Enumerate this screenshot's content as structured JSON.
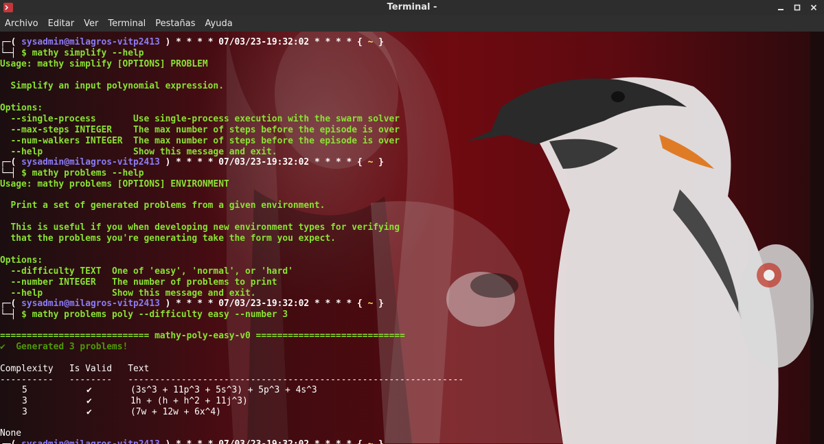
{
  "window": {
    "title": "Terminal -",
    "buttons": [
      "_",
      "□",
      "✕"
    ]
  },
  "menu": [
    "Archivo",
    "Editar",
    "Ver",
    "Terminal",
    "Pestañas",
    "Ayuda"
  ],
  "prompt": {
    "bracket_open": "┌─(",
    "user_host": "sysadmin@milagros-vitp2413",
    "stars_before": ") * * * *",
    "datetime": "07/03/23-19:32:02",
    "stars_after": "* * * *",
    "brace_open": "{",
    "cwd": "~",
    "brace_close": "}",
    "bracket_close": "└─┤",
    "dollar": "$"
  },
  "commands": {
    "c1": "mathy simplify --help",
    "c2": "mathy problems --help",
    "c3": "mathy problems poly --difficulty easy --number 3"
  },
  "output": {
    "simplify_usage": "Usage: mathy simplify [OPTIONS] PROBLEM",
    "simplify_desc": "  Simplify an input polynomial expression.",
    "options_header": "Options:",
    "opt1": "  --single-process       Use single-process execution with the swarm solver",
    "opt2": "  --max-steps INTEGER    The max number of steps before the episode is over",
    "opt3": "  --num-walkers INTEGER  The max number of steps before the episode is over",
    "opt4": "  --help                 Show this message and exit.",
    "problems_usage": "Usage: mathy problems [OPTIONS] ENVIRONMENT",
    "problems_desc": "  Print a set of generated problems from a given environment.",
    "problems_note1": "  This is useful if you when developing new environment types for verifying",
    "problems_note2": "  that the problems you're generating take the form you expect.",
    "popt1": "  --difficulty TEXT  One of 'easy', 'normal', or 'hard'",
    "popt2": "  --number INTEGER   The number of problems to print",
    "popt3": "  --help             Show this message and exit.",
    "env_banner": "============================ mathy-poly-easy-v0 ============================",
    "generated": "✔  Generated 3 problems!",
    "table_header": "Complexity   Is Valid   Text",
    "table_rule": "----------   --------   ---------------------------------------------------------------",
    "rows": [
      {
        "complexity": "5",
        "valid": "✔",
        "text": "(3s^3 + 11p^3 + 5s^3) + 5p^3 + 4s^3"
      },
      {
        "complexity": "3",
        "valid": "✔",
        "text": "1h + (h + h^2 + 11j^3)"
      },
      {
        "complexity": "3",
        "valid": "✔",
        "text": "(7w + 12w + 6x^4)"
      }
    ],
    "none": "None"
  },
  "colors": {
    "green": "#8ae234",
    "dark_green": "#4e9a06",
    "white": "#ffffff",
    "yellow": "#fce94f",
    "blue": "#8c7cf5",
    "titlebar": "#2d2d2d"
  }
}
